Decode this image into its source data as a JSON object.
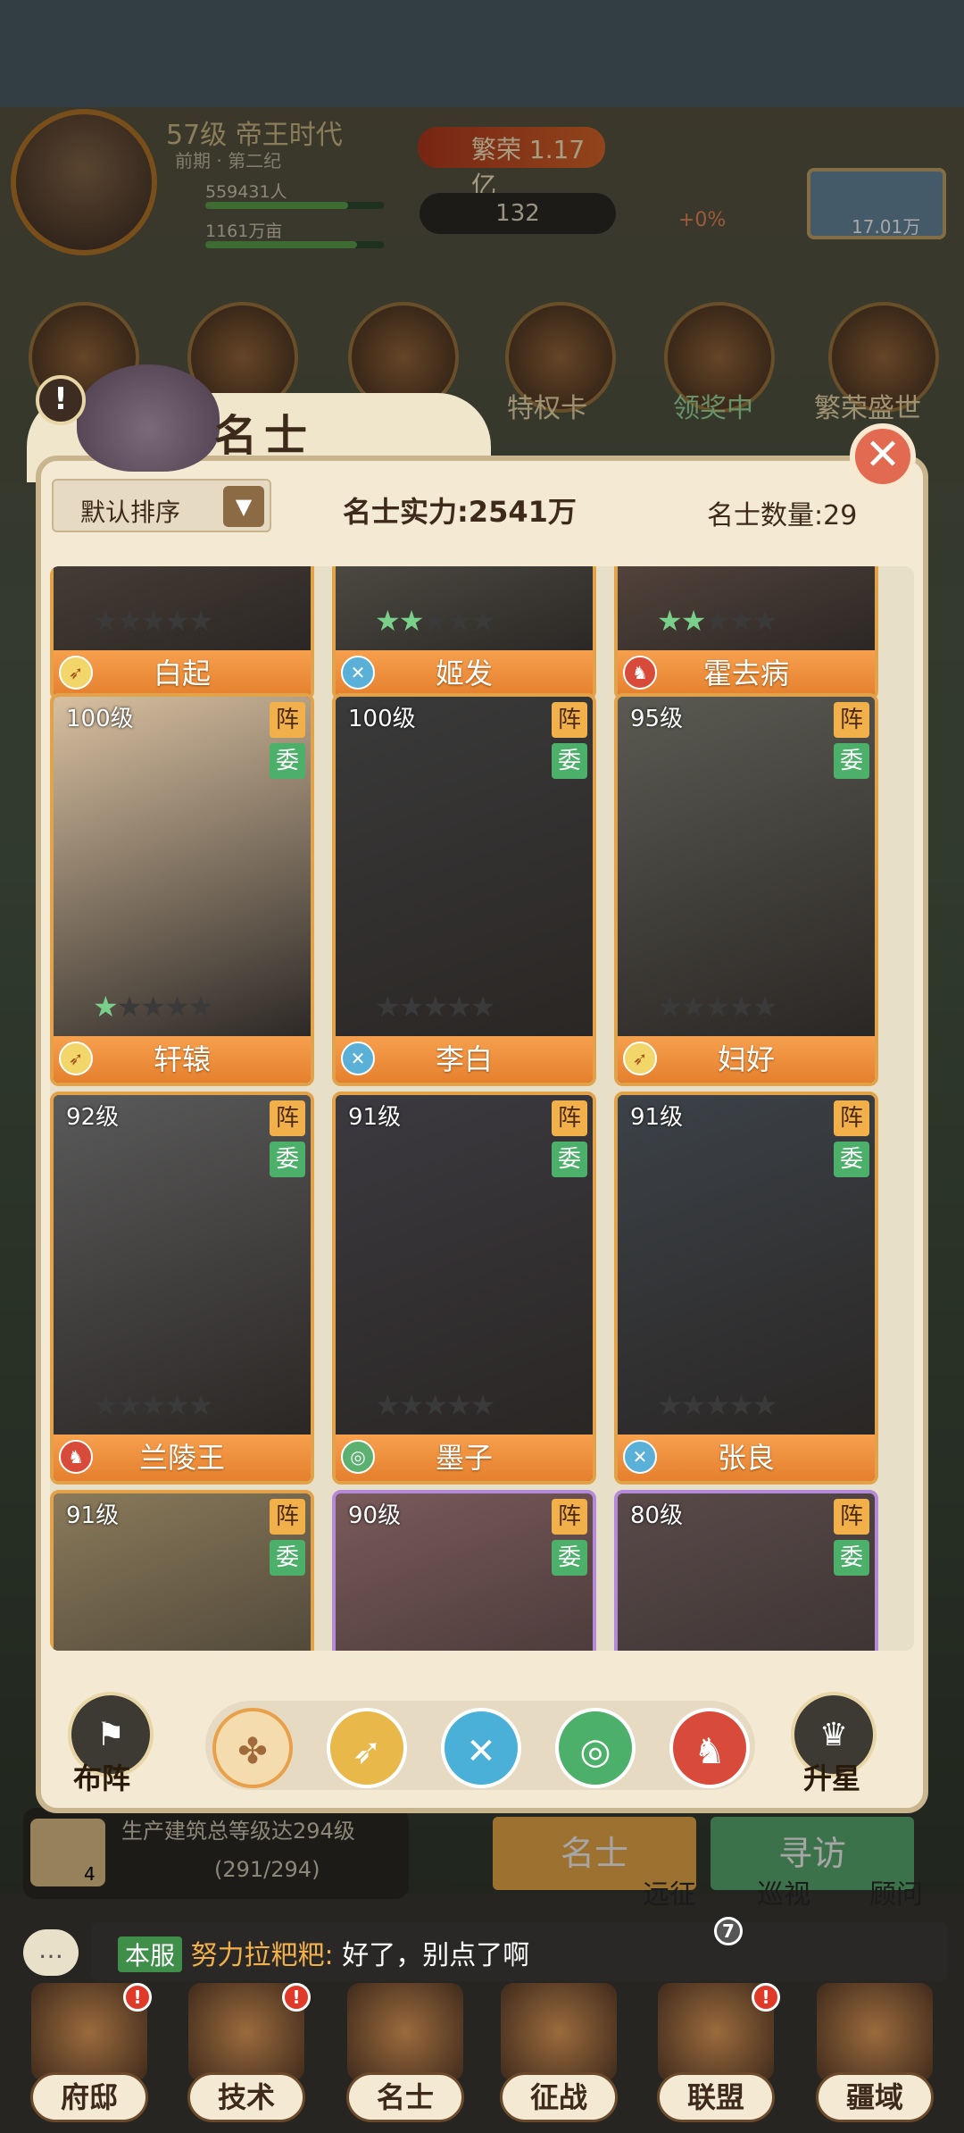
{
  "header": {
    "level_era": "57级 帝王时代",
    "sub_era": "前期 · 第二纪",
    "population": "559431人",
    "land": "1161万亩",
    "prosperity": "繁荣 1.17亿",
    "currency": "132",
    "growth": "+0%",
    "right_value": "17.01万"
  },
  "top_icons": [
    "特权卡",
    "领奖中",
    "繁荣盛世"
  ],
  "panel": {
    "title": "名士",
    "sort_label": "默认排序",
    "power": "名士实力:2541万",
    "count": "名士数量:29",
    "close": "✕"
  },
  "cards": [
    {
      "name": "白起",
      "level": "",
      "stars": 0,
      "class": "spear"
    },
    {
      "name": "姬发",
      "level": "",
      "stars": 2,
      "class": "bow"
    },
    {
      "name": "霍去病",
      "level": "",
      "stars": 2,
      "class": "horse"
    },
    {
      "name": "轩辕",
      "level": "100级",
      "stars": 1,
      "class": "spear"
    },
    {
      "name": "李白",
      "level": "100级",
      "stars": 0,
      "class": "bow"
    },
    {
      "name": "妇好",
      "level": "95级",
      "stars": 0,
      "class": "spear"
    },
    {
      "name": "兰陵王",
      "level": "92级",
      "stars": 0,
      "class": "horse"
    },
    {
      "name": "墨子",
      "level": "91级",
      "stars": 0,
      "class": "shield"
    },
    {
      "name": "张良",
      "level": "91级",
      "stars": 0,
      "class": "bow"
    },
    {
      "name": "",
      "level": "91级",
      "stars": 0,
      "class": "spear"
    },
    {
      "name": "",
      "level": "90级",
      "stars": 0,
      "class": "spear"
    },
    {
      "name": "",
      "level": "80级",
      "stars": 0,
      "class": "spear"
    }
  ],
  "badges": {
    "zhen": "阵",
    "wei": "委"
  },
  "controls": {
    "formation": "布阵",
    "upstar": "升星"
  },
  "quest": {
    "text": "生产建筑总等级达294级",
    "progress": "(291/294)",
    "count": "4"
  },
  "tabs": {
    "mingshi": "名士",
    "xunfang": "寻访"
  },
  "sub_nav": [
    "远征",
    "巡视",
    "顾问"
  ],
  "chat": {
    "tag": "本服",
    "sender": "努力拉粑粑:",
    "message": "好了，别点了啊"
  },
  "nav": [
    "府邸",
    "技术",
    "名士",
    "征战",
    "联盟",
    "疆域"
  ],
  "nav_badge_count": "7"
}
